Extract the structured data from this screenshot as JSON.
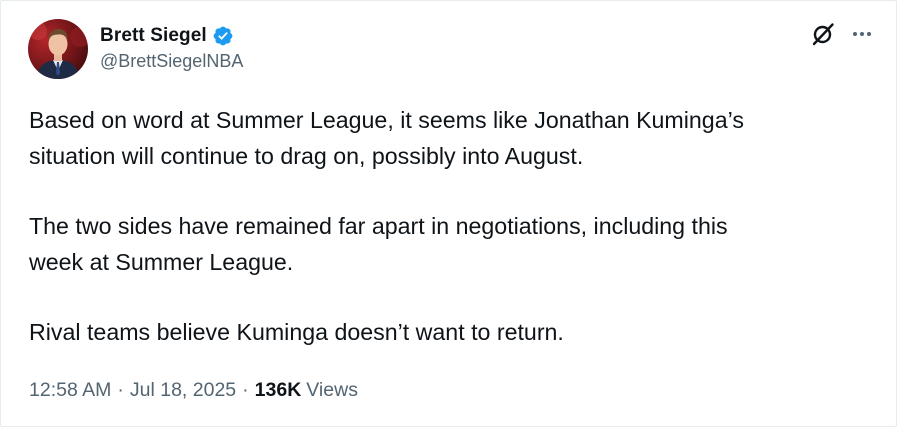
{
  "author": {
    "display_name": "Brett Siegel",
    "handle": "@BrettSiegelNBA",
    "verified": true,
    "verified_color": "#1d9bf0"
  },
  "icons": {
    "verified": "verified-badge-icon",
    "grok": "grok-icon",
    "more": "more-options-icon"
  },
  "tweet": {
    "paragraphs": [
      "Based on word at Summer League, it seems like Jonathan Kuminga’s\nsituation will continue to drag on, possibly into August.",
      "The two sides have remained far apart in negotiations, including this\nweek at Summer League.",
      "Rival teams believe Kuminga doesn’t want to return."
    ],
    "time": "12:58 AM",
    "date": "Jul 18, 2025",
    "separator": "·",
    "views_count": "136K",
    "views_label": "Views"
  },
  "colors": {
    "text_primary": "#0f1419",
    "text_secondary": "#536471",
    "border": "#e6ecf0"
  }
}
